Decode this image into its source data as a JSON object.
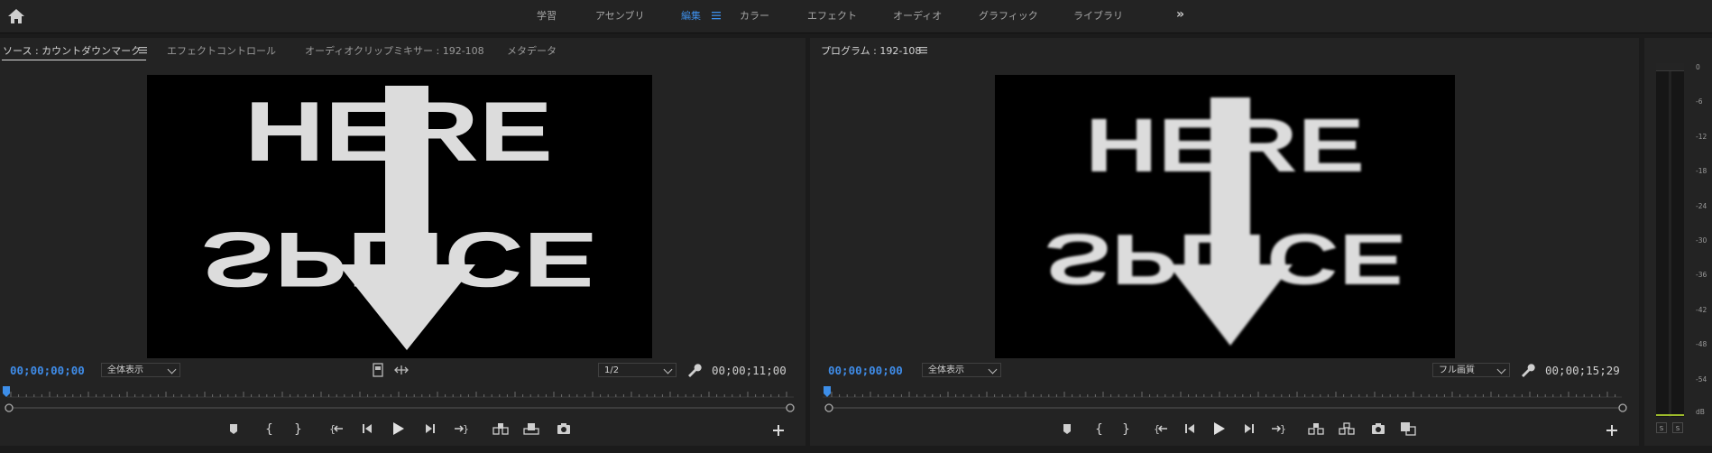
{
  "workspaces": {
    "items": [
      "学習",
      "アセンブリ",
      "編集",
      "カラー",
      "エフェクト",
      "オーディオ",
      "グラフィック",
      "ライブラリ"
    ],
    "active": "編集",
    "more_icon": "double-chevron-right-icon"
  },
  "source_panel": {
    "tabs": [
      "ソース : カウントダウンマーク",
      "エフェクトコントロール",
      "オーディオクリップミキサー : 192-108",
      "メタデータ"
    ],
    "active_tab": "ソース : カウントダウンマーク",
    "timecode": "00;00;00;00",
    "zoom_select": "全体表示",
    "resolution_select": "1/2",
    "duration": "00;00;11;00",
    "frame_text": {
      "top": "HERE",
      "bottom": "SPLICE"
    }
  },
  "program_panel": {
    "title": "プログラム : 192-108",
    "timecode": "00;00;00;00",
    "zoom_select": "全体表示",
    "quality_select": "フル画質",
    "duration": "00;00;15;29",
    "frame_text": {
      "top": "HERE",
      "bottom": "SPLICE"
    }
  },
  "audio_meter": {
    "scale": [
      "0",
      "-6",
      "-12",
      "-18",
      "-24",
      "-30",
      "-36",
      "-42",
      "-48",
      "-54",
      "dB"
    ],
    "solo_labels": [
      "S",
      "S"
    ]
  },
  "colors": {
    "accent": "#3d8ee8",
    "panel_bg": "#232323",
    "app_bg": "#1b1b1b"
  }
}
